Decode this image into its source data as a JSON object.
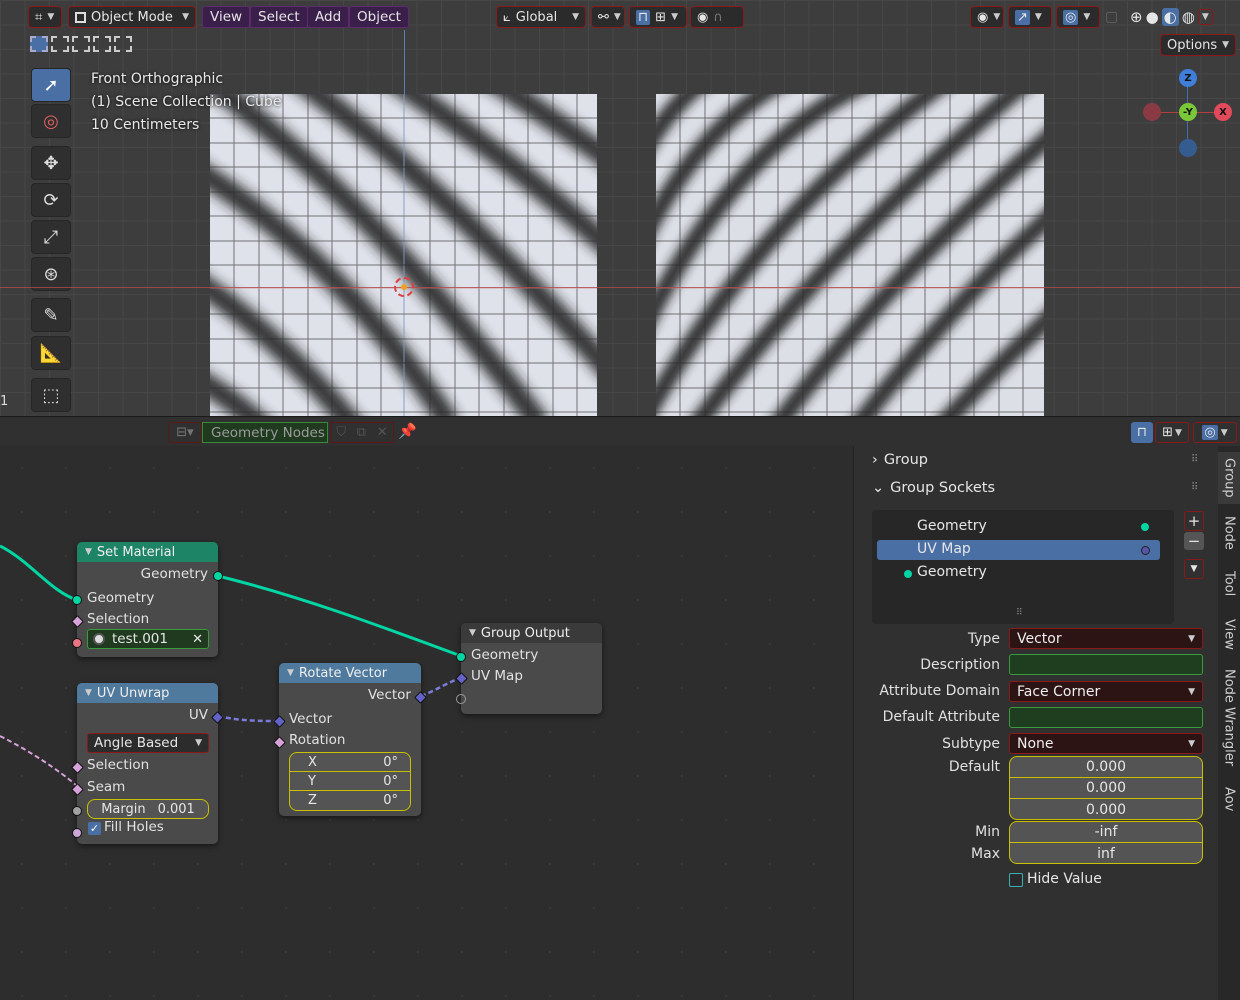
{
  "viewport": {
    "mode": "Object Mode",
    "menus": [
      "View",
      "Select",
      "Add",
      "Object"
    ],
    "orientation": "Global",
    "options_label": "Options",
    "overlay_lines": [
      "Front Orthographic",
      "(1) Scene Collection | Cube",
      "10 Centimeters"
    ],
    "axes": {
      "z": "Z",
      "neg_y": "-Y",
      "x": "X"
    },
    "left_marker": "1"
  },
  "node_editor": {
    "tree_name": "Geometry Nodes",
    "nodes": {
      "set_material": {
        "title": "Set Material",
        "out_geometry": "Geometry",
        "in_geometry": "Geometry",
        "selection": "Selection",
        "material": "test.001"
      },
      "uv_unwrap": {
        "title": "UV Unwrap",
        "uv": "UV",
        "method": "Angle Based",
        "selection": "Selection",
        "seam": "Seam",
        "margin_label": "Margin",
        "margin_value": "0.001",
        "fill_holes": "Fill Holes"
      },
      "rotate_vector": {
        "title": "Rotate Vector",
        "out_vector": "Vector",
        "in_vector": "Vector",
        "rotation": "Rotation",
        "x_label": "X",
        "x_value": "0°",
        "y_label": "Y",
        "y_value": "0°",
        "z_label": "Z",
        "z_value": "0°"
      },
      "group_output": {
        "title": "Group Output",
        "geometry": "Geometry",
        "uv_map": "UV Map"
      }
    }
  },
  "sidebar": {
    "group_header": "Group",
    "sockets_header": "Group Sockets",
    "sockets": [
      {
        "label": "Geometry",
        "kind": "output"
      },
      {
        "label": "UV Map",
        "kind": "output",
        "selected": true
      },
      {
        "label": "Geometry",
        "kind": "input"
      }
    ],
    "props": {
      "type_label": "Type",
      "type_value": "Vector",
      "description_label": "Description",
      "domain_label": "Attribute Domain",
      "domain_value": "Face Corner",
      "default_attr_label": "Default Attribute",
      "subtype_label": "Subtype",
      "subtype_value": "None",
      "default_label": "Default",
      "default_values": [
        "0.000",
        "0.000",
        "0.000"
      ],
      "min_label": "Min",
      "min_value": "-inf",
      "max_label": "Max",
      "max_value": "inf",
      "hide_value_label": "Hide Value"
    },
    "tabs": [
      "Group",
      "Node",
      "Tool",
      "View",
      "Node Wrangler",
      "Aov"
    ]
  },
  "colors": {
    "geometry_socket": "#00d6a3",
    "vector_socket": "#6363c7",
    "selected_row": "#4a6fa5",
    "set_material_header": "#1e8466",
    "uv_unwrap_header": "#4f7a9e"
  }
}
